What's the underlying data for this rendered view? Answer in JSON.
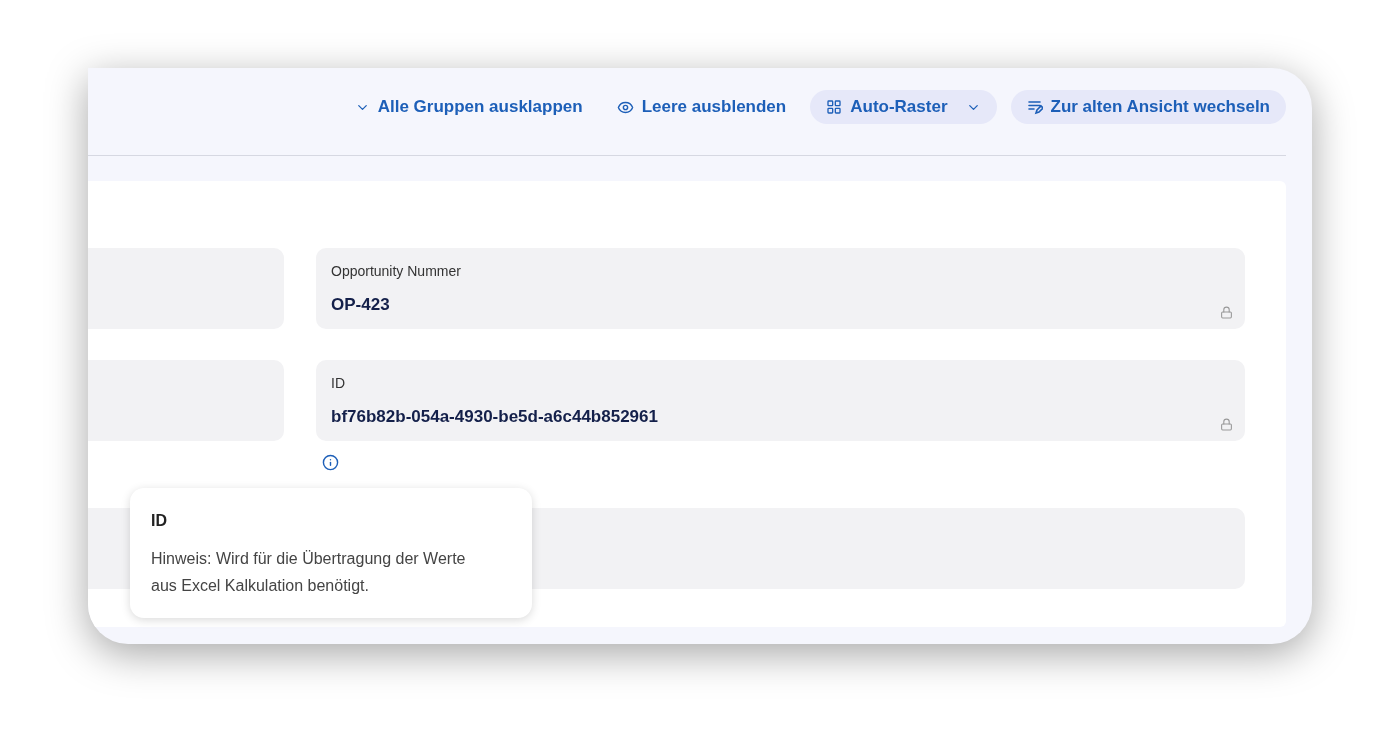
{
  "toolbar": [
    {
      "kind": "link",
      "label": "Alle Gruppen ausklappen",
      "dropdown": false
    },
    {
      "kind": "link",
      "label": "Leere ausblenden",
      "dropdown": false
    },
    {
      "kind": "pill",
      "label": "Auto-Raster",
      "dropdown": true
    },
    {
      "kind": "pill",
      "label": "Zur alten Ansicht wechseln",
      "dropdown": false
    }
  ],
  "fields": [
    {
      "label": "Opportunity Nummer",
      "value": "OP-423",
      "locked": true,
      "info": false
    },
    {
      "label": "ID",
      "value": "bf76b82b-054a-4930-be5d-a6c44b852961",
      "locked": true,
      "info": true
    }
  ],
  "tooltip": {
    "title": "ID",
    "text": "Hinweis: Wird für die Übertragung der Werte aus Excel Kalkulation benötigt."
  }
}
